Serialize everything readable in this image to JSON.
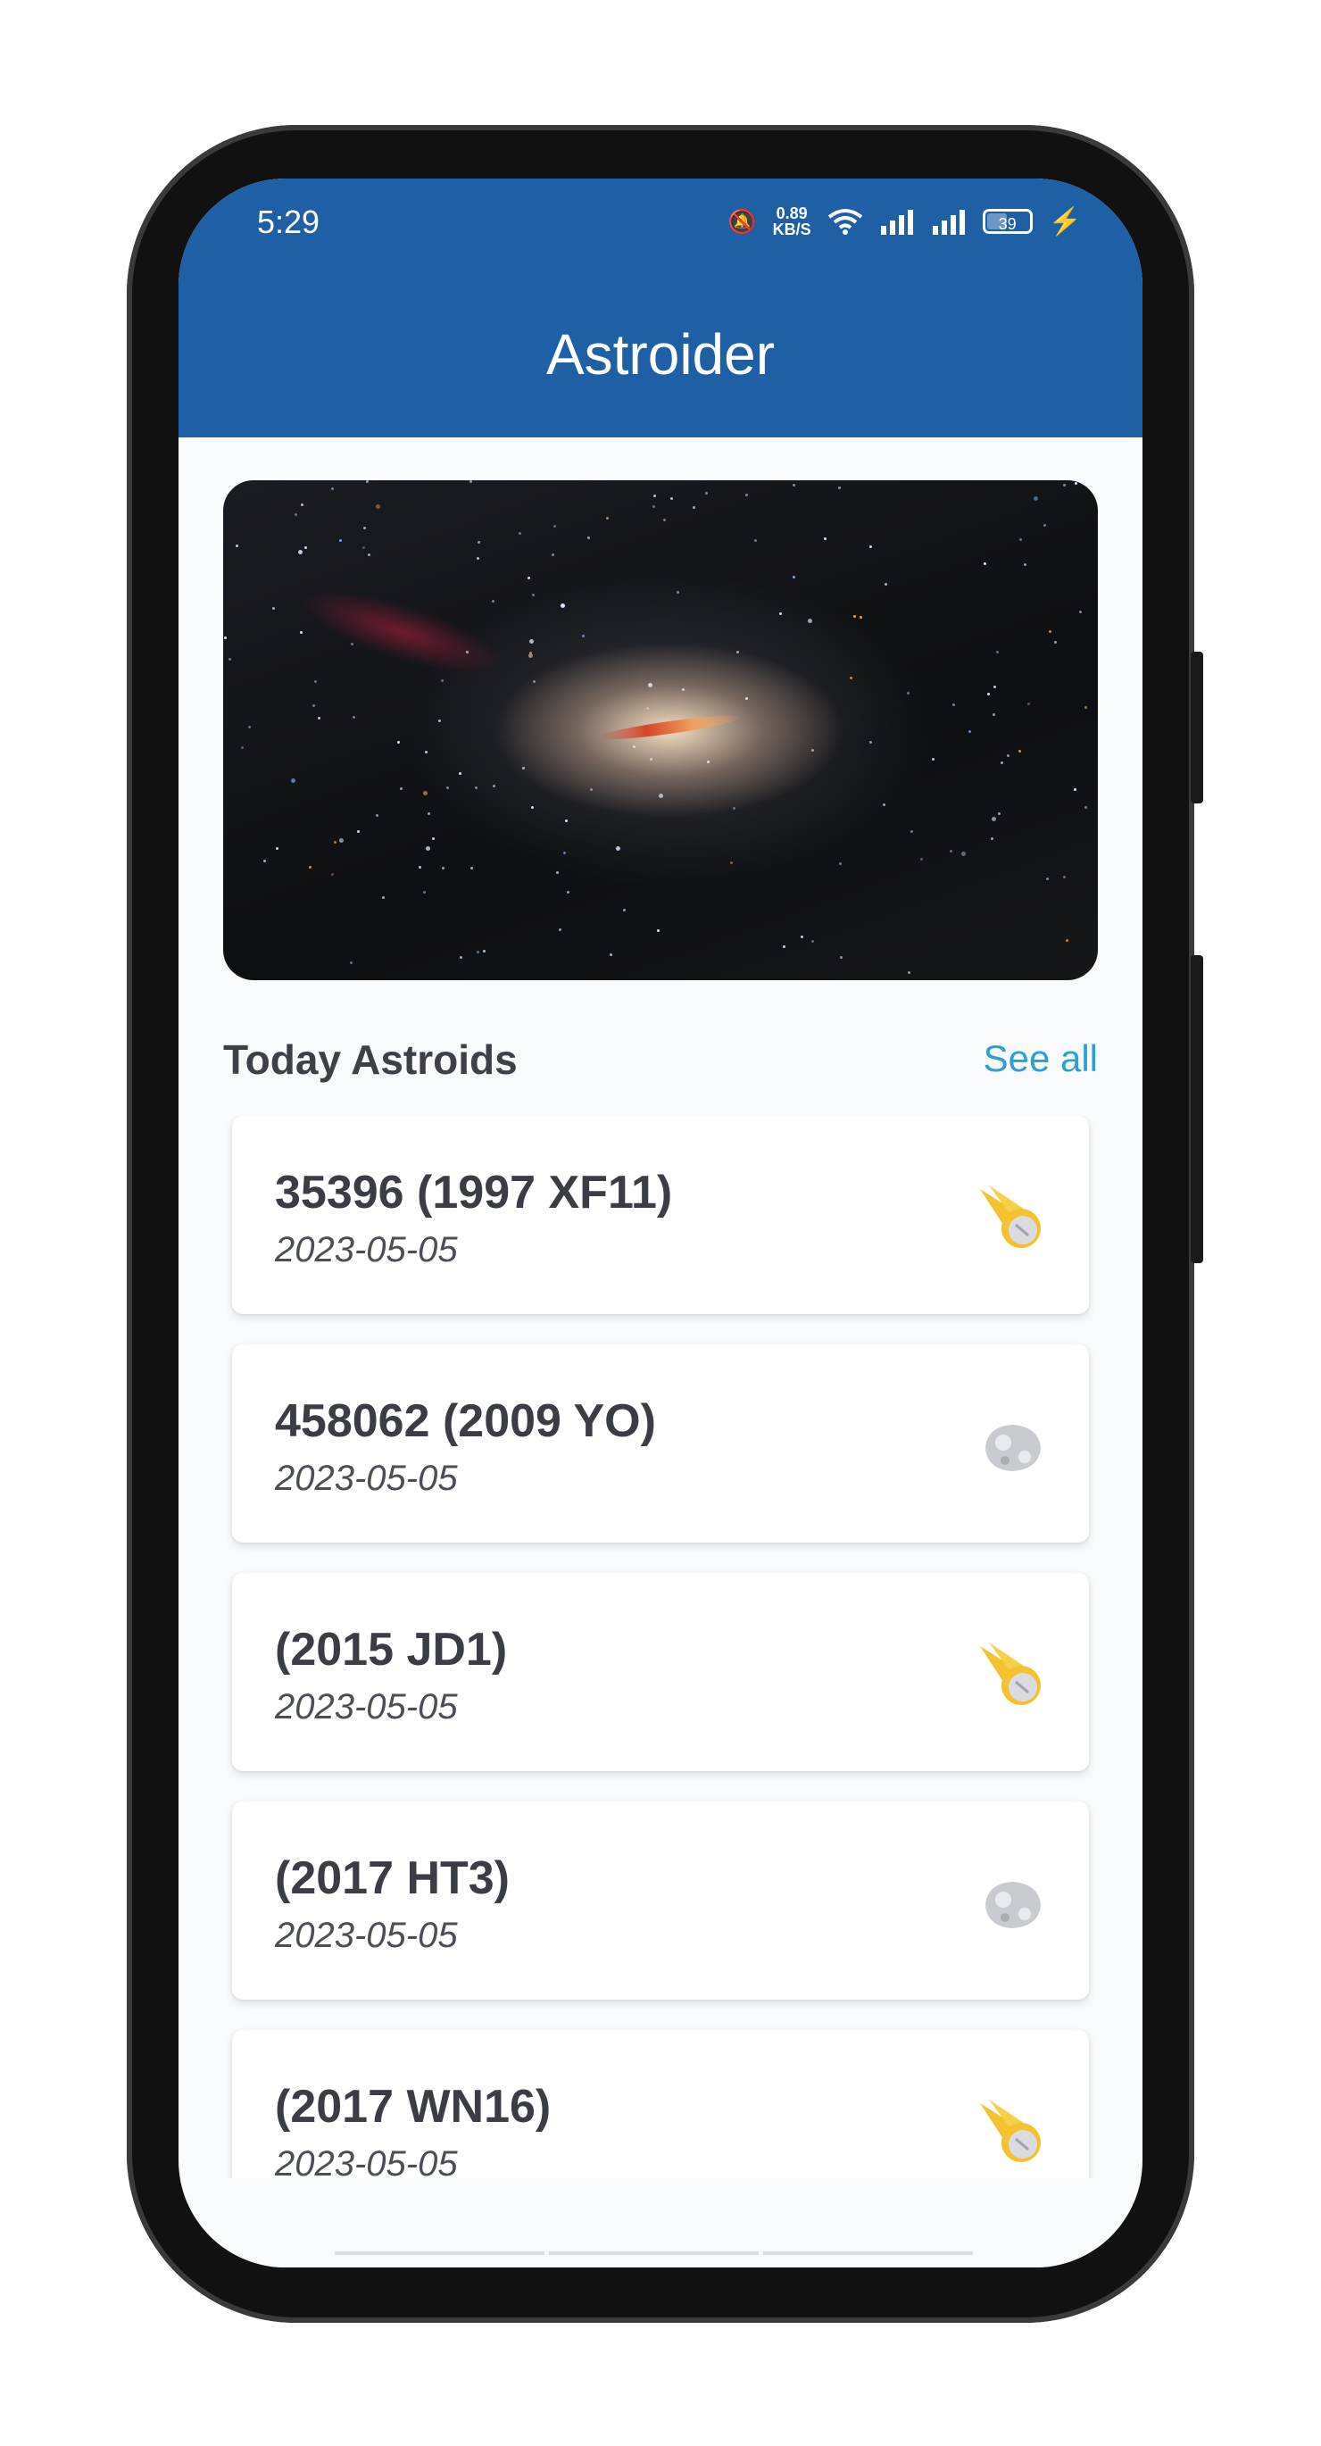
{
  "status_bar": {
    "time": "5:29",
    "speed_value": "0.89",
    "speed_unit": "KB/S",
    "battery": "39"
  },
  "app": {
    "title": "Astroider",
    "bar_color": "#1f5fa6"
  },
  "hero_image": {
    "icon": "galaxy-image"
  },
  "today_section": {
    "title": "Today Astroids",
    "see_all": "See all"
  },
  "asteroids": [
    {
      "name": "35396 (1997 XF11)",
      "date": "2023-05-05",
      "icon": "meteor-icon"
    },
    {
      "name": "458062 (2009 YO)",
      "date": "2023-05-05",
      "icon": "asteroid-icon"
    },
    {
      "name": "(2015 JD1)",
      "date": "2023-05-05",
      "icon": "meteor-icon"
    },
    {
      "name": "(2017 HT3)",
      "date": "2023-05-05",
      "icon": "asteroid-icon"
    },
    {
      "name": "(2017 WN16)",
      "date": "2023-05-05",
      "icon": "meteor-icon"
    }
  ],
  "colors": {
    "accent": "#2d9fd2",
    "meteor": "#f2c230",
    "rock": "#c9cbd0"
  }
}
